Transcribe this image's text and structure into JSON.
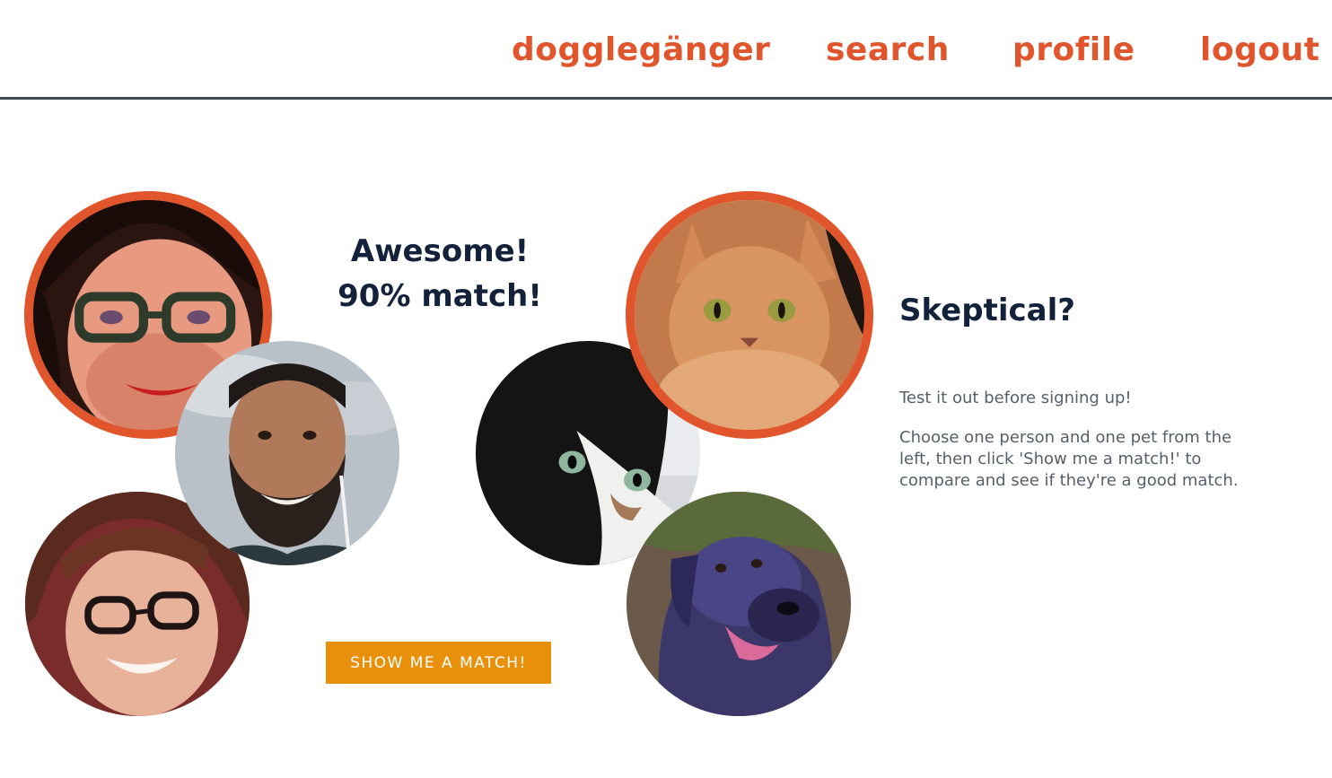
{
  "nav": {
    "brand": "dogglegänger",
    "search": "search",
    "profile": "profile",
    "logout": "logout"
  },
  "result": {
    "line1": "Awesome!",
    "line2": "90% match!"
  },
  "button": {
    "label": "SHOW ME A MATCH!"
  },
  "sidebar": {
    "title": "Skeptical?",
    "paragraph1": "Test it out before signing up!",
    "paragraph2": "Choose one person and one pet from the left, then click 'Show me a match!' to compare and see if they're a good match."
  },
  "colors": {
    "accent": "#e0552b",
    "button": "#e8900a",
    "heading": "#13213a",
    "body_text": "#55606a"
  }
}
